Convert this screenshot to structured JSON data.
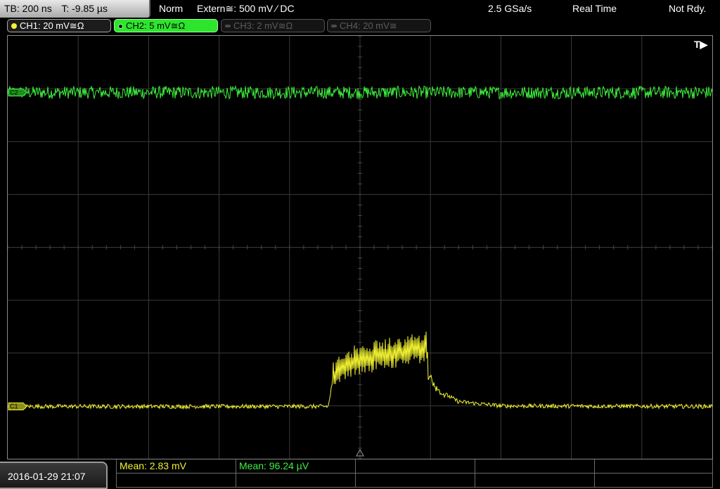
{
  "top_bar": {
    "timebase": "TB: 200 ns",
    "trigger_time": "T: -9.85 µs",
    "trigger_mode": "Norm",
    "trigger_source": "Extern≅: 500 mV ⁄ DC",
    "sample_rate": "2.5 GSa/s",
    "acquisition_mode": "Real Time",
    "status": "Not Rdy."
  },
  "channels": [
    {
      "label": "CH1: 20 mV≅Ω",
      "state": "on",
      "color": "#f2f232"
    },
    {
      "label": "CH2: 5 mV≅Ω",
      "state": "selected",
      "color": "#3df03d"
    },
    {
      "label": "CH3: 2 mV≅Ω",
      "state": "off",
      "color": "#5c5c5c"
    },
    {
      "label": "CH4: 20 mV≅",
      "state": "off",
      "color": "#5c5c5c"
    }
  ],
  "screen": {
    "trigger_marker": "T▶",
    "ch1_marker": "C1",
    "ch2_marker": "C2"
  },
  "measurements": [
    {
      "label": "Mean: 2.83 mV",
      "color": "#f2f232"
    },
    {
      "label": "Mean: 96.24 µV",
      "color": "#3df03d"
    }
  ],
  "datetime": "2016-01-29 21:07",
  "chart_data": {
    "type": "line",
    "grid": {
      "divisions_x": 10,
      "divisions_y": 8
    },
    "x_range_div": [
      0,
      10
    ],
    "y_range_div": [
      0,
      8
    ],
    "series": [
      {
        "name": "CH2",
        "color": "#3df03d",
        "level_div": 6.93,
        "noise_div": 0.12
      },
      {
        "name": "CH1",
        "color": "#f2f232",
        "points_div": [
          [
            0,
            0.99
          ],
          [
            4.55,
            0.99
          ],
          [
            4.62,
            1.55
          ],
          [
            4.75,
            1.75
          ],
          [
            5.0,
            1.89
          ],
          [
            5.5,
            2.0
          ],
          [
            5.95,
            2.12
          ],
          [
            5.97,
            1.6
          ],
          [
            6.1,
            1.3
          ],
          [
            6.4,
            1.08
          ],
          [
            7.0,
            1.0
          ],
          [
            10,
            0.99
          ]
        ],
        "ripple_div": 0.28,
        "noise_div": 0.04
      }
    ]
  }
}
